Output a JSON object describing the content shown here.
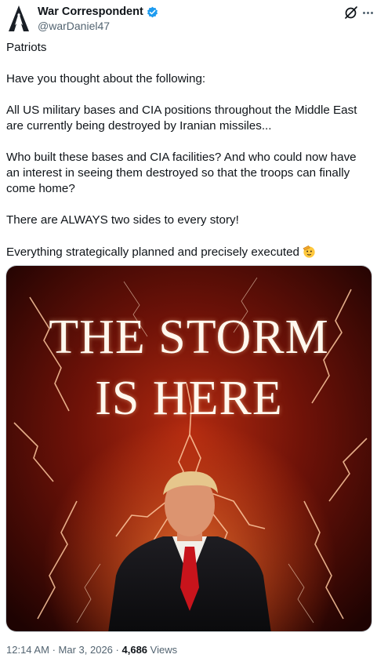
{
  "author": {
    "display_name": "War Correspondent",
    "handle": "@warDaniel47",
    "verified_badge_color": "#1d9bf0"
  },
  "actions": {
    "grok_icon": "grok-icon",
    "more_icon": "more-icon"
  },
  "post": {
    "paragraphs": [
      "Patriots",
      "Have you thought about the following:",
      "All US military bases and CIA positions throughout the Middle East are currently being destroyed by Iranian missiles...",
      "Who built these bases and CIA facilities? And who could now have an interest in seeing them destroyed so that the troops can finally come home?",
      "There are ALWAYS two sides to every story!",
      "Everything strategically planned and precisely executed"
    ],
    "emoji": "saluting-face-emoji"
  },
  "media": {
    "headline_line1": "THE STORM",
    "headline_line2": "IS HERE",
    "accent_colors": {
      "sky": "#3a0704",
      "glow": "#ff6a2a",
      "lightning": "#ffd2a8"
    }
  },
  "meta": {
    "time": "12:14 AM",
    "separator": "·",
    "date": "Mar 3, 2026",
    "views_count": "4,686",
    "views_label": "Views"
  }
}
